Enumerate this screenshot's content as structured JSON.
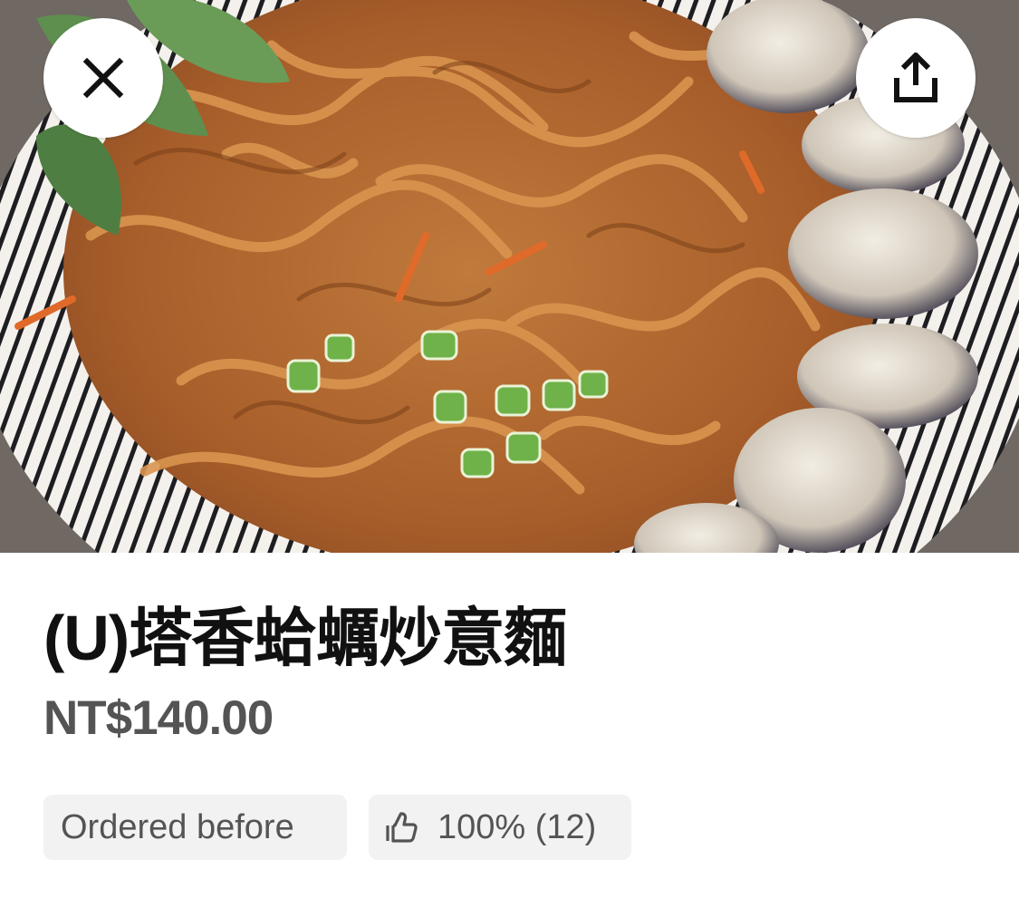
{
  "item": {
    "photo_alt": "",
    "title": "(U)塔香蛤蠣炒意麵",
    "price": "NT$140.00"
  },
  "header": {
    "close_icon": "close-icon",
    "share_icon": "share-icon"
  },
  "badges": {
    "ordered_before": "Ordered before",
    "rating_icon": "thumbs-up-icon",
    "rating_text": "100% (12)"
  },
  "colors": {
    "title_text": "#111111",
    "secondary_text": "#545454",
    "chip_background": "#f2f2f2",
    "button_background": "#ffffff"
  }
}
